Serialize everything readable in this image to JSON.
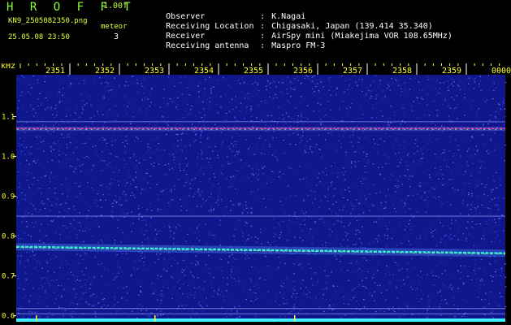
{
  "header": {
    "app_title": "H R O F F T",
    "version": "1.00f",
    "filename": "KN9_2505082350.png",
    "meteor_label": "meteor",
    "meteor_count": "3",
    "datetime": "25.05.08 23:50",
    "info": [
      {
        "label": "Observer",
        "value": "K.Nagai"
      },
      {
        "label": "Receiving Location",
        "value": "Chigasaki, Japan (139.414 35.340)"
      },
      {
        "label": "Receiver",
        "value": "AirSpy mini (Miakejima VOR 108.65MHz)"
      },
      {
        "label": "Receiving antenna",
        "value": "Maspro FM-3"
      }
    ]
  },
  "chart_data": {
    "type": "heatmap",
    "ylabel": "kHz",
    "y_ticks": [
      "1.1",
      "1.0",
      "0.9",
      "0.8",
      "0.7",
      "0.6"
    ],
    "y_tick_values": [
      1.1,
      1.0,
      0.9,
      0.8,
      0.7,
      0.6
    ],
    "ylim": [
      0.585,
      1.205
    ],
    "x_ticks": [
      "2351",
      "2352",
      "2353",
      "2354",
      "2355",
      "2356",
      "2357",
      "2358",
      "2359",
      "0000"
    ],
    "signal_bands_khz": [
      1.07,
      0.765
    ],
    "reference_lines_khz": [
      1.087,
      0.85,
      0.618,
      0.605
    ],
    "colors": {
      "background": "#10168c",
      "noise": "#3a46d8",
      "band_upper": "#e84090",
      "band_lower": "#30f0d0",
      "baseline": "#40f0ff",
      "axis_text": "#ffff33"
    }
  }
}
